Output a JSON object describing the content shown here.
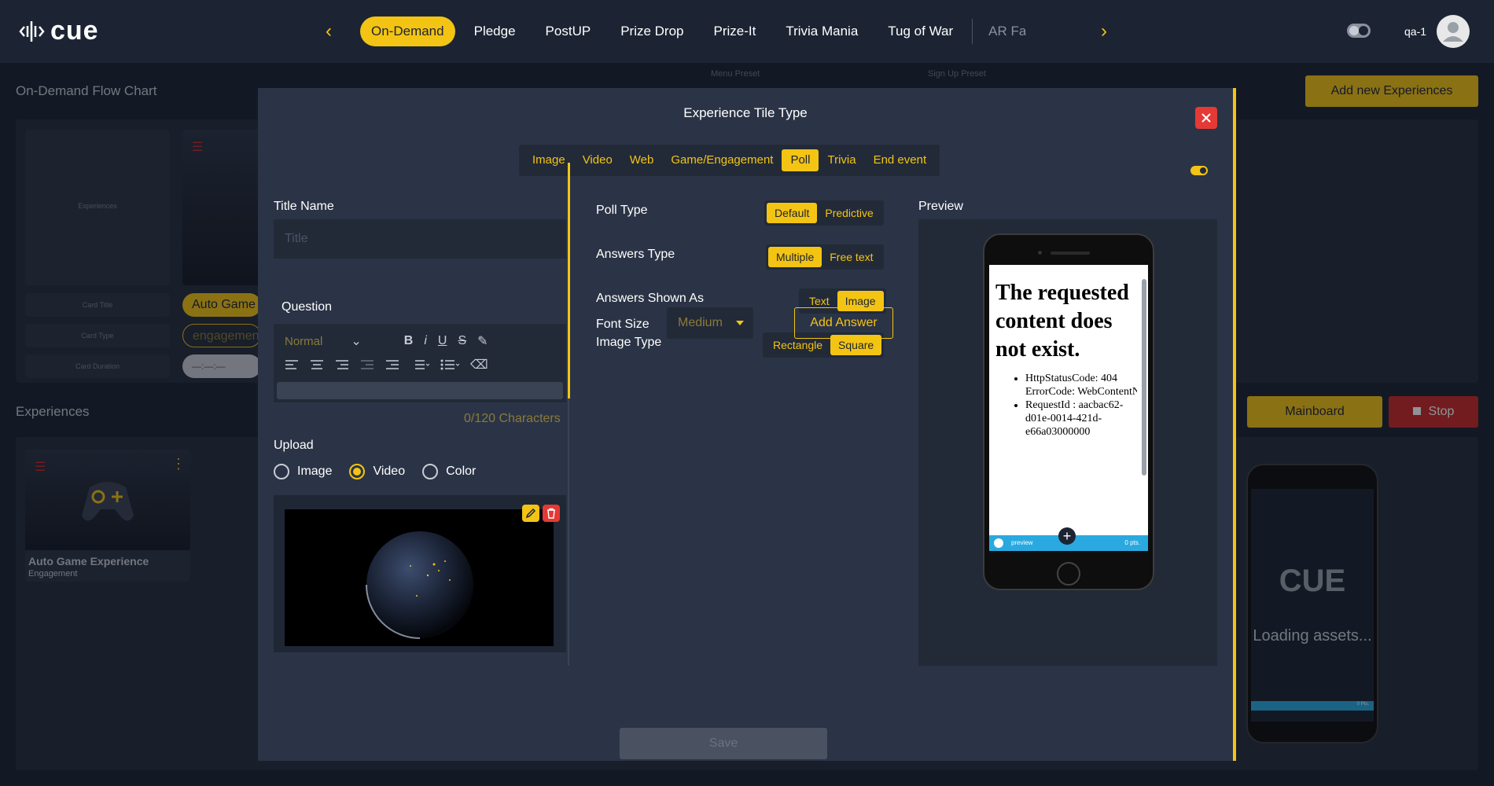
{
  "brand": {
    "logo_text": "cue",
    "accent": "#f3c413"
  },
  "nav": {
    "items": [
      "On-Demand",
      "Pledge",
      "PostUP",
      "Prize Drop",
      "Prize-It",
      "Trivia Mania",
      "Tug of War",
      "AR Fa"
    ],
    "active_index": 0
  },
  "user": {
    "name": "qa-1"
  },
  "background": {
    "flow_chart_label": "On-Demand Flow Chart",
    "experiences_label": "Experiences",
    "add_new_button": "Add new Experiences",
    "mainboard_button": "Mainboard",
    "stop_button": "Stop",
    "menu_preset_label": "Menu Preset",
    "signup_preset_label": "Sign Up Preset",
    "flow_placeholder_experiences": "Experiences",
    "flow_placeholder_card_title": "Card Title",
    "flow_placeholder_card_type": "Card Type",
    "flow_placeholder_card_duration": "Card Duration",
    "flow_pill_auto_game": "Auto Game",
    "flow_pill_engagement": "engagement",
    "flow_pill_duration": "—:—:—",
    "experience_card_title": "Auto Game Experience",
    "experience_card_subtitle": "Engagement",
    "phone_cue_text": "CUE",
    "phone_loading": "Loading assets...",
    "phone_bar_points": "0 Pts."
  },
  "modal": {
    "title": "Experience Tile Type",
    "type_tabs": [
      "Image",
      "Video",
      "Web",
      "Game/Engagement",
      "Poll",
      "Trivia",
      "End event"
    ],
    "active_type": "Poll",
    "title_name_label": "Title Name",
    "title_placeholder": "Title",
    "question_label": "Question",
    "editor_format": "Normal",
    "char_count": "0/120 Characters",
    "upload_label": "Upload",
    "upload_options": [
      "Image",
      "Video",
      "Color"
    ],
    "upload_selected": "Video",
    "poll_type_label": "Poll Type",
    "poll_type_options": [
      "Default",
      "Predictive"
    ],
    "poll_type_selected": "Default",
    "answers_type_label": "Answers Type",
    "answers_type_options": [
      "Multiple",
      "Free text"
    ],
    "answers_type_selected": "Multiple",
    "answers_shown_label": "Answers Shown As",
    "answers_shown_options": [
      "Text",
      "Image"
    ],
    "answers_shown_selected": "Image",
    "image_type_label": "Image Type",
    "image_type_options": [
      "Rectangle",
      "Square"
    ],
    "image_type_selected": "Square",
    "font_size_label": "Font Size",
    "font_size_value": "Medium",
    "add_answer_button": "Add Answer",
    "preview_label": "Preview",
    "save_button": "Save"
  },
  "preview_phone": {
    "error_heading": "The requested content does not exist.",
    "error_items": [
      "HttpStatusCode: 404",
      "ErrorCode: WebContentNotFound",
      "RequestId : aacbac62-d01e-0014-421d-e66a03000000"
    ],
    "bar_left": "preview",
    "bar_right": "0 pts."
  }
}
